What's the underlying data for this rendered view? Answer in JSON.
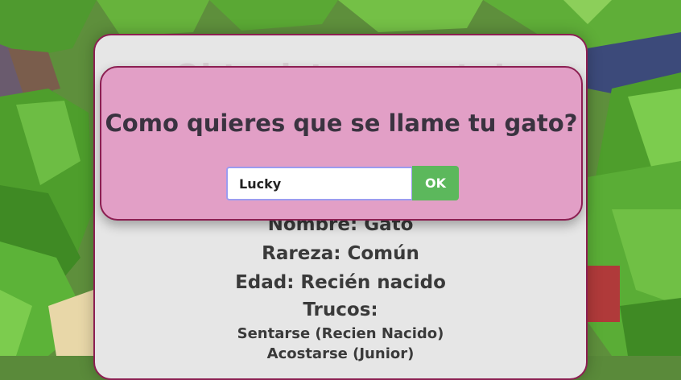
{
  "info_card": {
    "title": "Obtuviste un gato!",
    "name_line": "Nombre: Gato",
    "rarity_line": "Rareza: Común",
    "age_line": "Edad: Recién nacido",
    "tricks_label": "Trucos:",
    "tricks": [
      "Sentarse (Recien Nacido)",
      "Acostarse (Junior)"
    ]
  },
  "dialog": {
    "question": "Como quieres que se llame tu gato?",
    "input_value": "Lucky",
    "ok_label": "OK"
  },
  "colors": {
    "dialog_bg": "#e29fc6",
    "border": "#8c1f52",
    "ok_button": "#5cb85c",
    "card_bg": "#e6e6e6"
  },
  "icons": [
    "cat-pet-image"
  ]
}
